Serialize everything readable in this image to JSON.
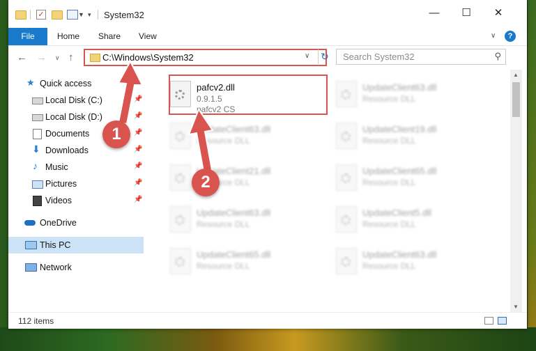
{
  "window": {
    "title": "System32"
  },
  "ribbon": {
    "tabs": [
      "File",
      "Home",
      "Share",
      "View"
    ],
    "help": "?"
  },
  "address": {
    "path": "C:\\Windows\\System32",
    "refresh": "↻"
  },
  "search": {
    "placeholder": "Search System32"
  },
  "sidebar": {
    "items": [
      {
        "label": "Quick access",
        "icon": "star-icon"
      },
      {
        "label": "Local Disk (C:)",
        "icon": "drive-icon",
        "pinned": true
      },
      {
        "label": "Local Disk (D:)",
        "icon": "drive-icon",
        "pinned": true
      },
      {
        "label": "Documents",
        "icon": "document-icon",
        "pinned": true
      },
      {
        "label": "Downloads",
        "icon": "download-icon",
        "pinned": true
      },
      {
        "label": "Music",
        "icon": "music-icon",
        "pinned": true
      },
      {
        "label": "Pictures",
        "icon": "picture-icon",
        "pinned": true
      },
      {
        "label": "Videos",
        "icon": "video-icon",
        "pinned": true
      },
      {
        "label": "OneDrive",
        "icon": "cloud-icon"
      },
      {
        "label": "This PC",
        "icon": "computer-icon",
        "selected": true
      },
      {
        "label": "Network",
        "icon": "network-icon"
      }
    ]
  },
  "files": [
    {
      "name": "pafcv2.dll",
      "version": "0.9.1.5",
      "description": "pafcv2 CS",
      "highlighted": true
    },
    {
      "name": "UpdateClient63.dll",
      "version": "",
      "description": "Resource DLL"
    },
    {
      "name": "UpdateClient63.dll",
      "version": "",
      "description": "Resource DLL"
    },
    {
      "name": "UpdateClient19.dll",
      "version": "",
      "description": "Resource DLL"
    },
    {
      "name": "UpdateClient21.dll",
      "version": "",
      "description": "Resource DLL"
    },
    {
      "name": "UpdateClient65.dll",
      "version": "",
      "description": "Resource DLL"
    },
    {
      "name": "UpdateClient63.dll",
      "version": "",
      "description": "Resource DLL"
    },
    {
      "name": "UpdateClient5.dll",
      "version": "",
      "description": "Resource DLL"
    },
    {
      "name": "UpdateClient65.dll",
      "version": "",
      "description": "Resource DLL"
    },
    {
      "name": "UpdateClient63.dll",
      "version": "",
      "description": "Resource DLL"
    }
  ],
  "status": {
    "item_count": "112 items"
  },
  "annotations": {
    "step1": "1",
    "step2": "2",
    "color": "#d9534f"
  }
}
